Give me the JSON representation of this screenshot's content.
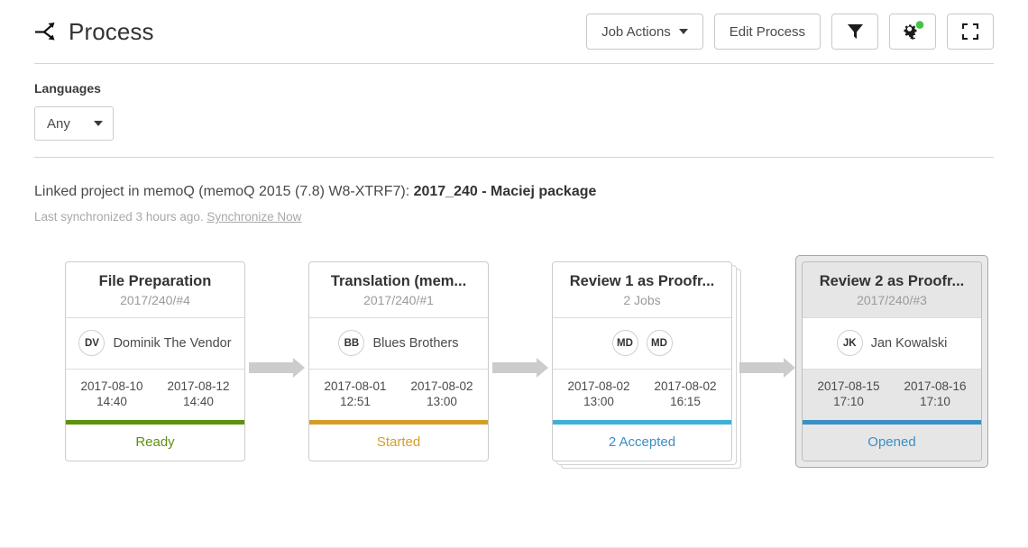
{
  "header": {
    "title": "Process",
    "icon": "process-branch-icon",
    "toolbar": {
      "job_actions_label": "Job Actions",
      "edit_process_label": "Edit Process",
      "filter_icon": "funnel-filter-icon",
      "settings_icon": "gears-settings-icon",
      "settings_badge_color": "#45c24a",
      "fullscreen_icon": "expand-fullscreen-icon"
    }
  },
  "filters": {
    "languages_label": "Languages",
    "languages_value": "Any"
  },
  "linked_project": {
    "prefix": "Linked project in memoQ (memoQ 2015 (7.8) W8-XTRF7): ",
    "name": "2017_240 - Maciej package",
    "sync_text": "Last synchronized 3 hours ago. ",
    "sync_link": "Synchronize Now"
  },
  "workflow": {
    "nodes": [
      {
        "title": "File Preparation",
        "subtitle": "2017/240/#4",
        "people": [
          {
            "initials": "DV",
            "name": "Dominik The Vendor"
          }
        ],
        "start_date": "2017-08-10",
        "start_time": "14:40",
        "end_date": "2017-08-12",
        "end_time": "14:40",
        "status": "Ready",
        "status_color": "#5c9210",
        "selected": false,
        "stacked": false
      },
      {
        "title": "Translation (mem...",
        "subtitle": "2017/240/#1",
        "people": [
          {
            "initials": "BB",
            "name": "Blues Brothers"
          }
        ],
        "start_date": "2017-08-01",
        "start_time": "12:51",
        "end_date": "2017-08-02",
        "end_time": "13:00",
        "status": "Started",
        "status_color": "#d69d26",
        "selected": false,
        "stacked": false
      },
      {
        "title": "Review 1 as Proofr...",
        "subtitle": "2 Jobs",
        "people": [
          {
            "initials": "MD",
            "name": ""
          },
          {
            "initials": "MD",
            "name": ""
          }
        ],
        "start_date": "2017-08-02",
        "start_time": "13:00",
        "end_date": "2017-08-02",
        "end_time": "16:15",
        "status": "2 Accepted",
        "status_color": "#3fafd8",
        "selected": false,
        "stacked": true
      },
      {
        "title": "Review 2 as Proofr...",
        "subtitle": "2017/240/#3",
        "people": [
          {
            "initials": "JK",
            "name": "Jan Kowalski"
          }
        ],
        "start_date": "2017-08-15",
        "start_time": "17:10",
        "end_date": "2017-08-16",
        "end_time": "17:10",
        "status": "Opened",
        "status_color": "#3a8fc4",
        "selected": true,
        "stacked": false
      }
    ]
  }
}
